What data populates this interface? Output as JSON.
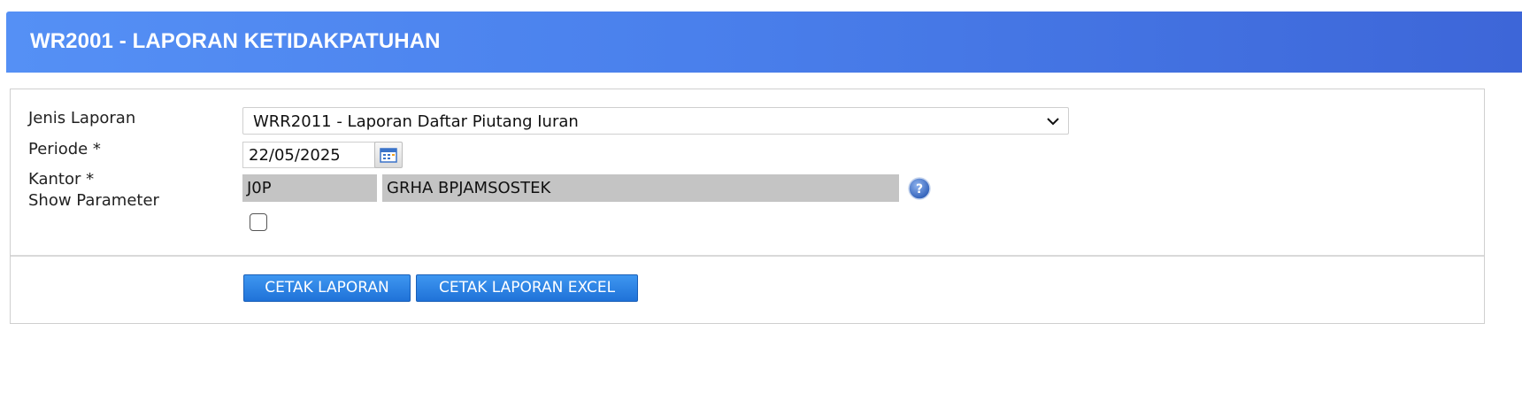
{
  "header": {
    "title": "WR2001 - LAPORAN KETIDAKPATUHAN"
  },
  "form": {
    "jenis_laporan": {
      "label": "Jenis Laporan",
      "value": "WRR2011 - Laporan Daftar Piutang Iuran"
    },
    "periode": {
      "label": "Periode *",
      "value": "22/05/2025"
    },
    "kantor": {
      "label": "Kantor *",
      "code": "J0P",
      "name": "GRHA BPJAMSOSTEK"
    },
    "show_parameter": {
      "label": "Show Parameter",
      "checked": false
    }
  },
  "actions": {
    "cetak_laporan": "CETAK LAPORAN",
    "cetak_laporan_excel": "CETAK LAPORAN EXCEL"
  },
  "colors": {
    "header_gradient_start": "#5590f5",
    "header_gradient_end": "#3d66d8",
    "button_blue": "#2a80e4",
    "readonly_gray": "#c4c4c4"
  },
  "icons": [
    "chevron-down-icon",
    "calendar-icon",
    "help-icon"
  ]
}
